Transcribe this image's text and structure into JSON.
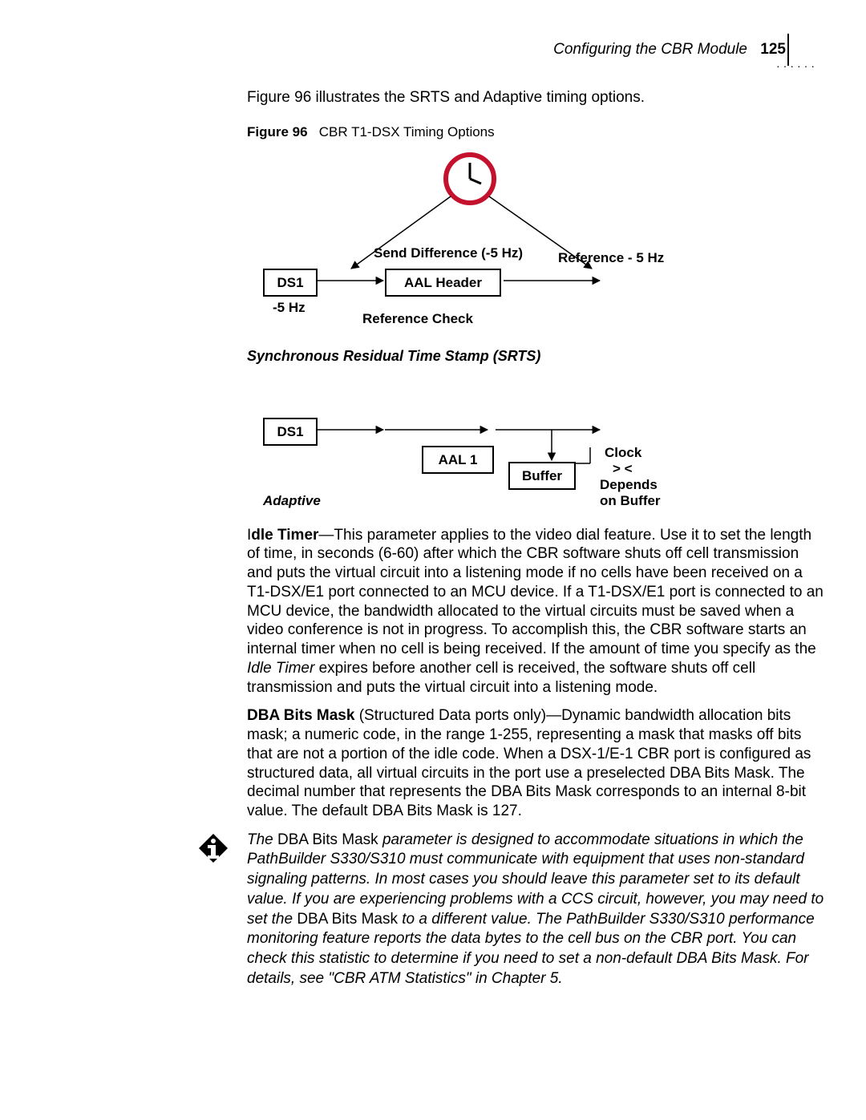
{
  "header": {
    "title": "Configuring the CBR Module",
    "page": "125"
  },
  "intro": "Figure 96 illustrates the SRTS and Adaptive timing options.",
  "figcap": {
    "num": "Figure 96",
    "title": "CBR T1-DSX Timing Options"
  },
  "diag1": {
    "send_diff": "Send Difference (-5 Hz)",
    "ref_5hz": "Reference  - 5 Hz",
    "ds1": "DS1",
    "aal_header": "AAL Header",
    "minus5": "-5 Hz",
    "ref_check": "Reference Check",
    "title": "Synchronous Residual Time Stamp (SRTS)"
  },
  "diag2": {
    "ds1": "DS1",
    "aal1": "AAL 1",
    "buffer": "Buffer",
    "clock1": "Clock",
    "clock2": ">  <",
    "clock3": "Depends",
    "clock4": "on Buffer",
    "title": "Adaptive"
  },
  "p1a": "I",
  "p1b": "dle Timer",
  "p1c": "—This parameter applies to the video dial feature. Use it to set the length of time, in seconds (6-60) after which the CBR software shuts off cell transmission and puts the virtual circuit into a listening mode if no cells have been received on a T1-DSX/E1 port connected to an MCU device. If a T1-DSX/E1 port is connected to an MCU device, the bandwidth allocated to the virtual circuits must be saved when a video conference is not in progress. To accomplish this, the CBR software starts an internal timer when no cell is being received. If the amount of time you specify as the ",
  "p1d": "Idle Timer",
  "p1e": " expires before another cell is received, the software shuts off cell transmission and puts the virtual circuit into a listening mode.",
  "p2a": "DBA Bits Mask",
  "p2b": " (Structured Data ports only)—Dynamic bandwidth allocation bits mask; a numeric code, in the range 1-255, representing a mask that masks off bits that are not a portion of the idle code. When a DSX-1/E-1 CBR port is configured as structured data, all virtual circuits in the port use a preselected DBA Bits Mask. The decimal number that represents the DBA Bits Mask corresponds to an internal 8-bit value. The default DBA Bits Mask is 127.",
  "note_a": "The ",
  "note_b": "DBA Bits Mask",
  "note_c": " parameter is designed to accommodate situations in which the PathBuilder S330/S310 must communicate with equipment that uses non-standard signaling patterns. In most cases you should leave this parameter set to its default value. If you are experiencing problems with a CCS circuit, however, you may need to set the ",
  "note_d": "DBA Bits Mask",
  "note_e": " to a different value. The PathBuilder S330/S310 performance monitoring feature reports the data bytes to the cell bus on the CBR port. You can check this statistic to determine if you need to set a non-default DBA Bits Mask. For details, see \"CBR ATM Statistics\" in Chapter 5."
}
